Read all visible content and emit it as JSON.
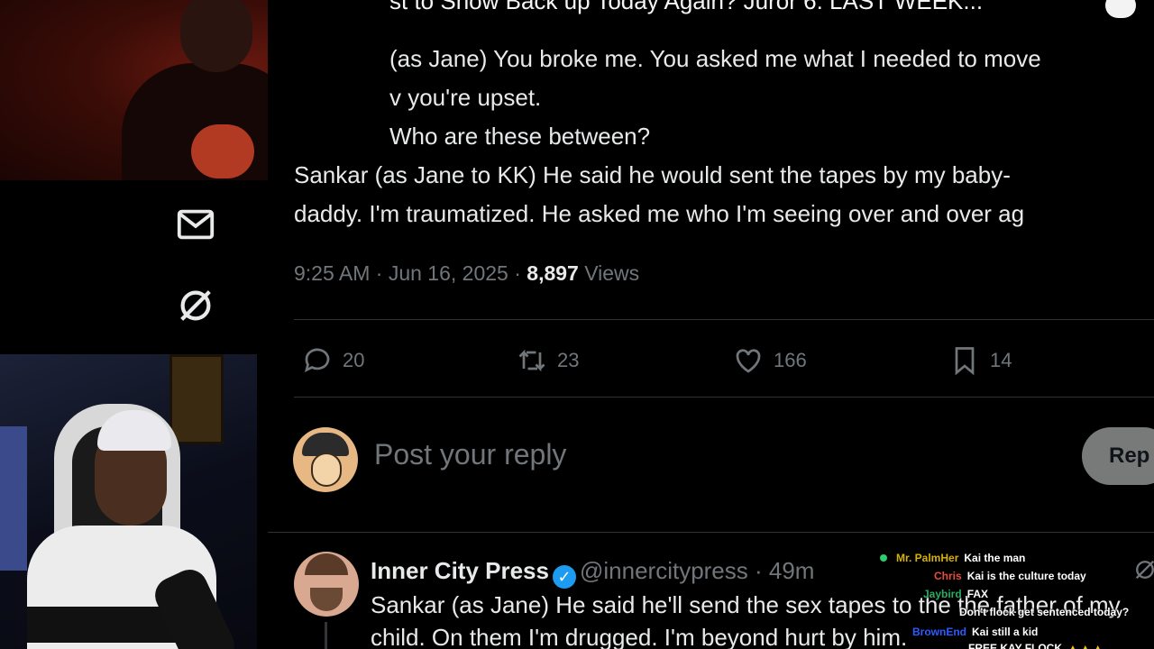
{
  "video_title": "st to Show Back up Today Again? Juror 6: LAST WEEK...",
  "tweet": {
    "lines": [
      "(as Jane) You broke me. You asked me what I needed to move",
      "v you're upset.",
      "Who are these between?",
      "Sankar (as Jane to KK) He said he would sent the tapes by my baby-",
      "daddy. I'm traumatized. He asked me who I'm seeing over and over ag"
    ],
    "time": "9:25 AM · Jun 16, 2025 · ",
    "views_count": "8,897",
    "views_label": "Views"
  },
  "actions": {
    "replies": "20",
    "reposts": "23",
    "likes": "166",
    "bookmarks": "14"
  },
  "reply_box": {
    "placeholder": "Post your reply",
    "button": "Rep"
  },
  "reply": {
    "name": "Inner City Press",
    "handle": "@innercitypress · 49m",
    "lines": [
      "Sankar (as Jane) He said he'll send the sex tapes to the the father of my",
      "child. On them I'm drugged. I'm beyond hurt by him."
    ]
  },
  "chat": [
    {
      "user": "Mr. PalmHer",
      "msg": "Kai the man",
      "color": "#d4b106"
    },
    {
      "user": "Chris",
      "msg": "Kai is the culture today",
      "color": "#e74c3c"
    },
    {
      "user": "Jaybird",
      "msg": "FAX",
      "color": "#27ae60"
    },
    {
      "user": "",
      "msg": "Don't flock get sentenced today?",
      "color": "#9b59b6"
    },
    {
      "user": "BrownEnd",
      "msg": "Kai still a kid",
      "color": "#2e5bff"
    },
    {
      "user": "",
      "msg": "FREE KAY FLOCK",
      "color": "#e74c3c"
    }
  ],
  "colors": {
    "accent_blue": "#1d9bf0",
    "secondary_text": "#71767b",
    "primary_text": "#e7e9ea",
    "divider": "#2f3336"
  },
  "icons": {
    "side": [
      "mail-icon",
      "grok-slash-icon"
    ],
    "actions": [
      "reply-icon",
      "repost-icon",
      "like-icon",
      "bookmark-icon"
    ]
  }
}
